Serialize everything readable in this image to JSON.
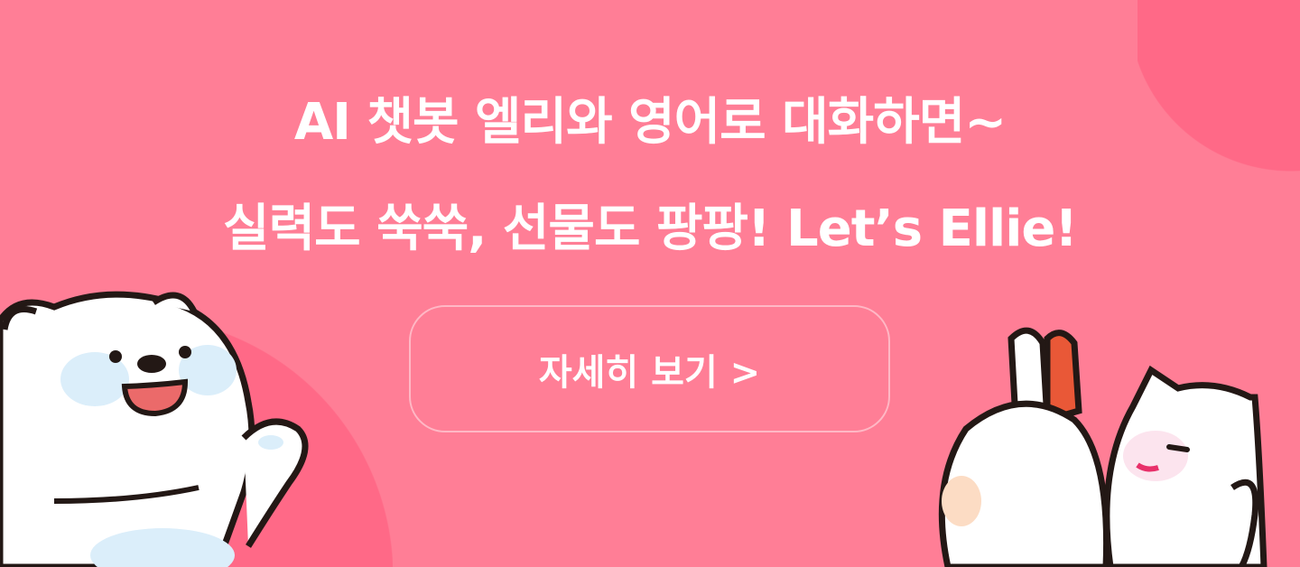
{
  "banner": {
    "headline_line1": "AI 챗봇 엘리와 영어로 대화하면~",
    "headline_line2": "실력도 쑥쑥, 선물도 팡팡! Let’s Ellie!",
    "cta_label": "자세히 보기 >"
  },
  "colors": {
    "background": "#ff7e96",
    "accent_circle": "#ff6987",
    "text": "#ffffff"
  }
}
